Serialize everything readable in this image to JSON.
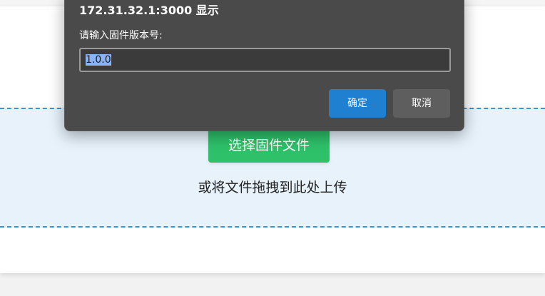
{
  "page": {
    "select_button_label": "选择固件文件",
    "drag_hint": "或将文件拖拽到此处上传"
  },
  "dialog": {
    "title": "172.31.32.1:3000 显示",
    "message": "请输入固件版本号:",
    "input_value": "1.0.0",
    "ok_label": "确定",
    "cancel_label": "取消"
  },
  "colors": {
    "accent_green": "#2ec16a",
    "accent_blue": "#1f7fd1",
    "dropzone_border": "#3b93d3",
    "dialog_bg": "#4a4a4a"
  }
}
